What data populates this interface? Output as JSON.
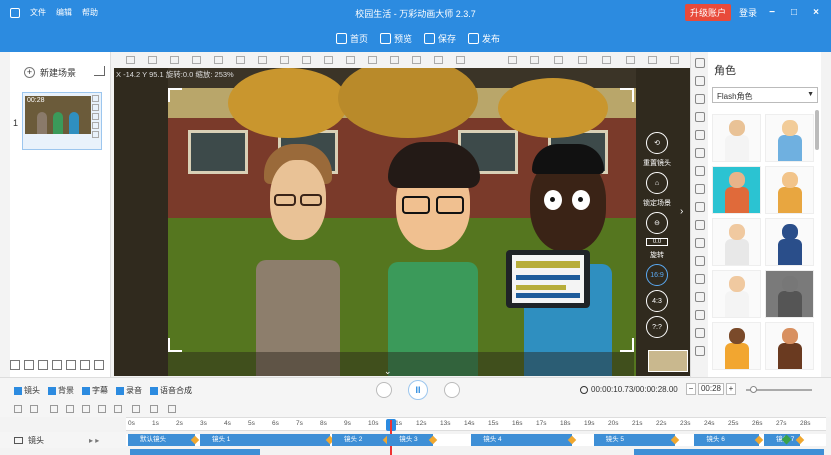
{
  "window": {
    "title": "校园生活 - 万彩动画大师 2.3.7",
    "menu": [
      "文件",
      "编辑",
      "帮助"
    ],
    "upgrade_label": "升级账户",
    "login_label": "登录",
    "min": "−",
    "max": "□",
    "close": "×"
  },
  "toolbar": {
    "home": "首页",
    "preview": "预览",
    "save": "保存",
    "publish": "发布"
  },
  "scenes": {
    "new_scene": "新建场景",
    "items": [
      {
        "index": "1",
        "time": "00:28"
      }
    ]
  },
  "canvas": {
    "coords": "X -14.2 Y 95.1 旋转:0.0 缩放: 253%",
    "camera": {
      "reset_label": "重置镜头",
      "lock_label": "锁定场景",
      "rotate_value": "0.0",
      "rotate_label": "旋转",
      "ratio_169": "16:9",
      "ratio_43": "4:3",
      "ratio_custom": "?:?"
    }
  },
  "right_panel": {
    "title": "角色",
    "dropdown_value": "Flash角色",
    "characters": [
      {
        "name": "char-1",
        "head": "#e9c296",
        "body": "#f4f4f4",
        "bg": "#fafafa"
      },
      {
        "name": "char-2",
        "head": "#f2cc99",
        "body": "#6fb0e0",
        "bg": "#fafafa"
      },
      {
        "name": "char-3",
        "head": "#e8b48a",
        "body": "#e06a3a",
        "bg": "#2bc3d2"
      },
      {
        "name": "char-4",
        "head": "#f2c48a",
        "body": "#e8a640",
        "bg": "#fafafa"
      },
      {
        "name": "char-5",
        "head": "#f0c9a0",
        "body": "#e8e8e8",
        "bg": "#fafafa"
      },
      {
        "name": "char-6",
        "head": "#2a4e8a",
        "body": "#2a4e8a",
        "bg": "#fafafa"
      },
      {
        "name": "char-7",
        "head": "#f0c9a0",
        "body": "#f4f4f4",
        "bg": "#fafafa"
      },
      {
        "name": "char-8",
        "head": "#777",
        "body": "#555",
        "bg": "#7a7a7a"
      },
      {
        "name": "char-9",
        "head": "#7a4a2a",
        "body": "#f2a630",
        "bg": "#fafafa"
      },
      {
        "name": "char-10",
        "head": "#d89060",
        "body": "#6a3a20",
        "bg": "#fafafa"
      }
    ]
  },
  "timeline": {
    "tabs": [
      "镜头",
      "背景",
      "字幕",
      "录音",
      "语音合成"
    ],
    "current_time": "00:00:10.73",
    "total_time": "00:00:28.00",
    "time_display": "00:00:10.73/00:00:28.00",
    "duration": "00:28",
    "ruler_ticks": [
      "0s",
      "1s",
      "2s",
      "3s",
      "4s",
      "5s",
      "6s",
      "7s",
      "8s",
      "9s",
      "10s",
      "11s",
      "12s",
      "13s",
      "14s",
      "15s",
      "16s",
      "17s",
      "18s",
      "19s",
      "20s",
      "21s",
      "22s",
      "23s",
      "24s",
      "25s",
      "26s",
      "27s",
      "28s"
    ],
    "track_label": "镜头",
    "segments": [
      "默认镜头",
      "镜头 1",
      "镜头 2",
      "镜头 3",
      "镜头 4",
      "镜头 5",
      "镜头 6",
      "镜头 7"
    ]
  }
}
